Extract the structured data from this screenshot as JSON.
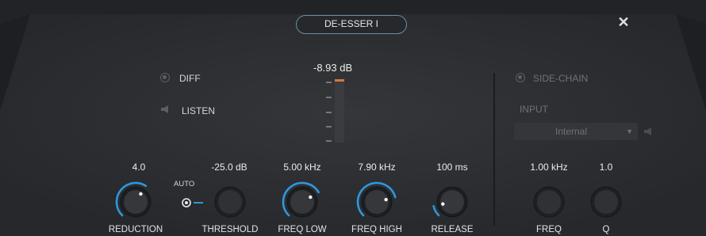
{
  "plugin": {
    "title": "DE-ESSER I",
    "close_icon": "close-icon"
  },
  "meter": {
    "value_label": "-8.93 dB",
    "level": 0.04,
    "accent_color": "#d9773a"
  },
  "options": {
    "diff_label": "DIFF",
    "listen_label": "LISTEN",
    "auto_label": "AUTO"
  },
  "controls": [
    {
      "id": "reduction",
      "label": "REDUCTION",
      "value": "4.0",
      "fraction": 0.62,
      "enabled": true
    },
    {
      "id": "threshold",
      "label": "THRESHOLD",
      "value": "-25.0 dB",
      "fraction": 0.0,
      "enabled": false
    },
    {
      "id": "freq_low",
      "label": "FREQ LOW",
      "value": "5.00 kHz",
      "fraction": 0.72,
      "enabled": true
    },
    {
      "id": "freq_high",
      "label": "FREQ HIGH",
      "value": "7.90 kHz",
      "fraction": 0.78,
      "enabled": true
    },
    {
      "id": "release",
      "label": "RELEASE",
      "value": "100 ms",
      "fraction": 0.12,
      "enabled": true
    }
  ],
  "sidechain": {
    "label": "SIDE-CHAIN",
    "input_label": "INPUT",
    "input_value": "Internal",
    "knobs": [
      {
        "id": "sc_freq",
        "label": "FREQ",
        "value": "1.00 kHz"
      },
      {
        "id": "sc_q",
        "label": "Q",
        "value": "1.0"
      }
    ]
  },
  "colors": {
    "accent": "#2f97dc",
    "panel": "#2a2c30"
  }
}
